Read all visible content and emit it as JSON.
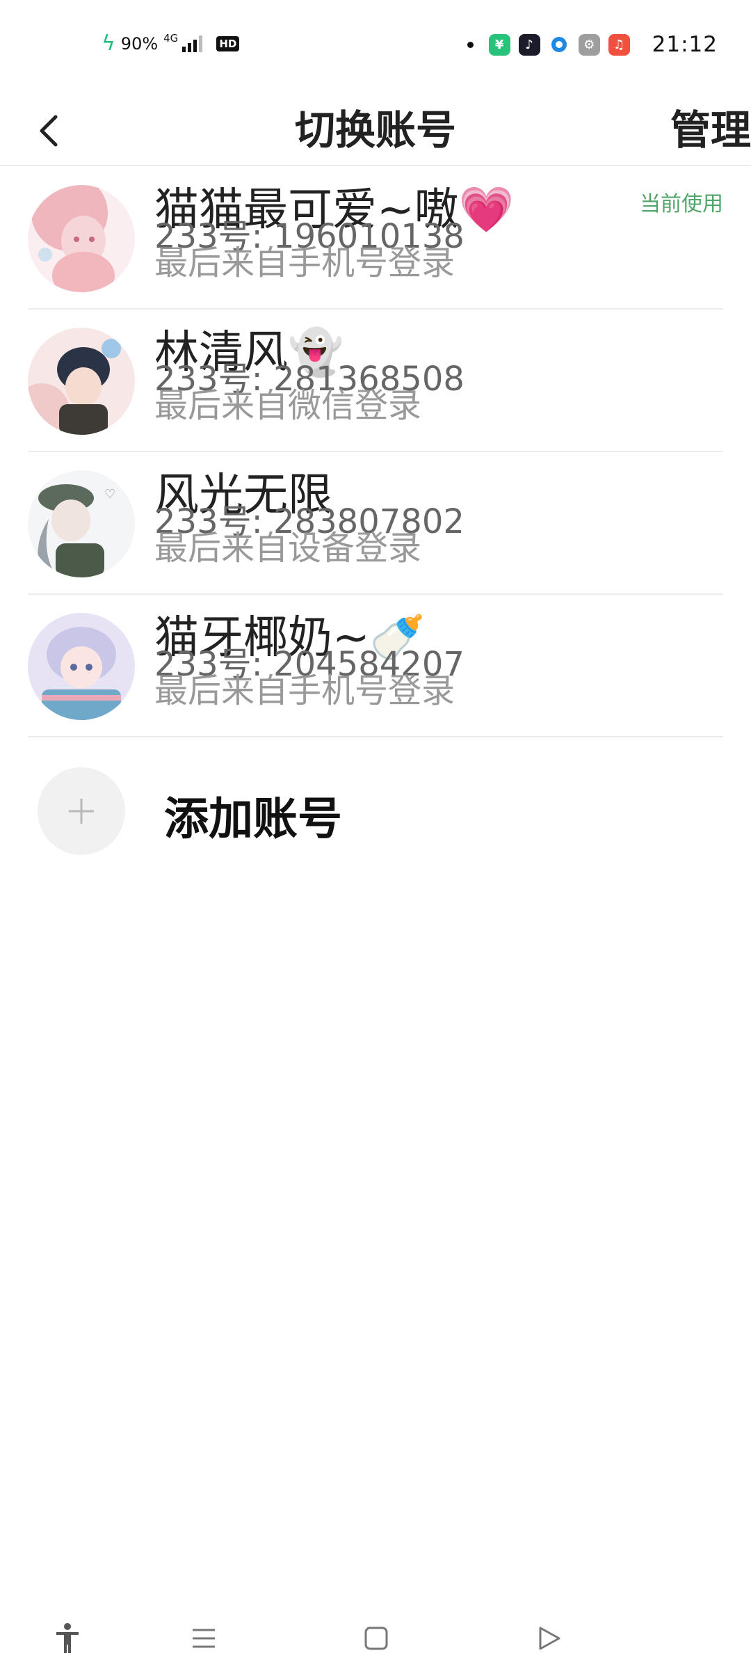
{
  "status_bar": {
    "battery_percent": "90%",
    "network_type": "4G",
    "hd_label": "HD",
    "time": "21:12",
    "app_icons": [
      {
        "name": "shop-app-icon",
        "color": "#27c37b"
      },
      {
        "name": "douyin-app-icon",
        "color": "#1b1b2a"
      },
      {
        "name": "browser-app-icon",
        "color": "#1e88e5"
      },
      {
        "name": "settings-app-icon",
        "color": "#9e9e9e"
      },
      {
        "name": "music-app-icon",
        "color": "#f0513f"
      }
    ]
  },
  "header": {
    "title": "切换账号",
    "manage_label": "管理"
  },
  "accounts": [
    {
      "name": "猫猫最可爱~嗷💗",
      "id_text": "233号: 196010138",
      "login_text": "最后来自手机号登录",
      "current_label": "当前使用",
      "avatar_colors": [
        "#f5d5d8",
        "#e58a93",
        "#fbeef0"
      ]
    },
    {
      "name": "林清风👻",
      "id_text": "233号: 281368508",
      "login_text": "最后来自微信登录",
      "avatar_colors": [
        "#2b3446",
        "#f0c9c9",
        "#5b6d8c"
      ]
    },
    {
      "name": "风光无限",
      "id_text": "233号: 283807802",
      "login_text": "最后来自设备登录",
      "avatar_colors": [
        "#e9ecef",
        "#4c5a4a",
        "#9aa3a9"
      ]
    },
    {
      "name": "猫牙椰奶~🍼",
      "id_text": "233号: 204584207",
      "login_text": "最后来自手机号登录",
      "avatar_colors": [
        "#c9c6e8",
        "#5a6a9e",
        "#e9a7b8"
      ]
    }
  ],
  "add_account": {
    "label": "添加账号"
  },
  "colors": {
    "accent_green": "#52a56a",
    "divider": "#ececec"
  }
}
